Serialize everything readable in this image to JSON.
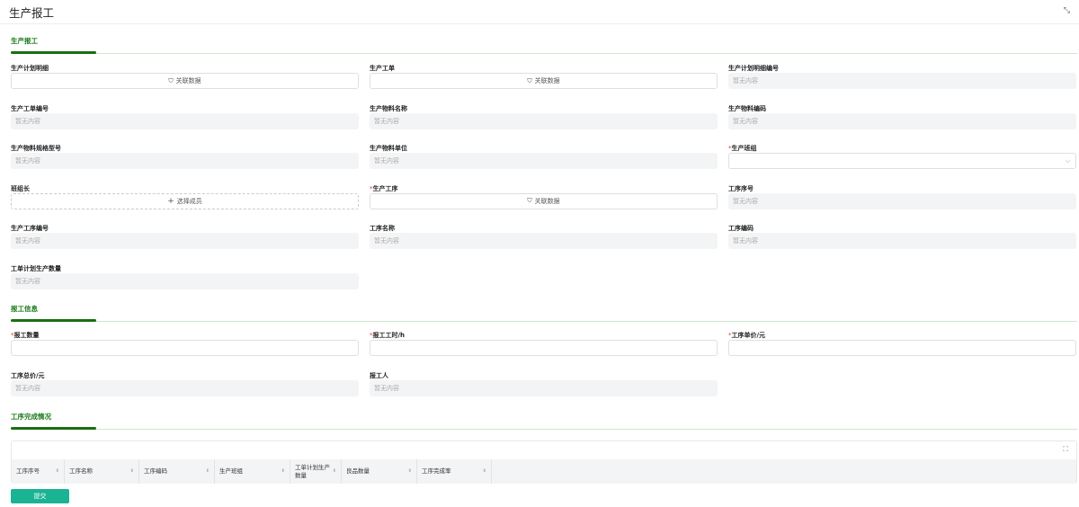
{
  "title": "生产报工",
  "sections": [
    {
      "title": "生产报工",
      "fields": [
        {
          "label": "生产计划明细",
          "required": false,
          "type": "link",
          "value": "关联数据"
        },
        {
          "label": "生产工单",
          "required": false,
          "type": "link",
          "value": "关联数据"
        },
        {
          "label": "生产计划明细编号",
          "required": false,
          "type": "ro",
          "value": "暂无内容"
        },
        {
          "label": "生产工单编号",
          "required": false,
          "type": "ro",
          "value": "暂无内容"
        },
        {
          "label": "生产物料名称",
          "required": false,
          "type": "ro",
          "value": "暂无内容"
        },
        {
          "label": "生产物料编码",
          "required": false,
          "type": "ro",
          "value": "暂无内容"
        },
        {
          "label": "生产物料规格型号",
          "required": false,
          "type": "ro",
          "value": "暂无内容"
        },
        {
          "label": "生产物料单位",
          "required": false,
          "type": "ro",
          "value": "暂无内容"
        },
        {
          "label": "生产班组",
          "required": true,
          "type": "sel",
          "value": ""
        },
        {
          "label": "班组长",
          "required": false,
          "type": "member",
          "value": "选择成员"
        },
        {
          "label": "生产工序",
          "required": true,
          "type": "link",
          "value": "关联数据"
        },
        {
          "label": "工序序号",
          "required": false,
          "type": "ro",
          "value": "暂无内容"
        },
        {
          "label": "生产工序编号",
          "required": false,
          "type": "ro",
          "value": "暂无内容"
        },
        {
          "label": "工序名称",
          "required": false,
          "type": "ro",
          "value": "暂无内容"
        },
        {
          "label": "工序编码",
          "required": false,
          "type": "ro",
          "value": "暂无内容"
        },
        {
          "label": "工单计划生产数量",
          "required": false,
          "type": "ro",
          "value": "暂无内容"
        }
      ]
    },
    {
      "title": "报工信息",
      "fields": [
        {
          "label": "报工数量",
          "required": true,
          "type": "inp",
          "value": ""
        },
        {
          "label": "报工工时/h",
          "required": true,
          "type": "inp",
          "value": ""
        },
        {
          "label": "工序单价/元",
          "required": true,
          "type": "inp",
          "value": ""
        },
        {
          "label": "工序总价/元",
          "required": false,
          "type": "ro",
          "value": "暂无内容"
        },
        {
          "label": "报工人",
          "required": false,
          "type": "ro",
          "value": "暂无内容"
        }
      ]
    },
    {
      "title": "工序完成情况"
    }
  ],
  "table": {
    "columns": [
      {
        "label": "工序序号",
        "w": 57
      },
      {
        "label": "工序名称",
        "w": 81
      },
      {
        "label": "工序编码",
        "w": 82
      },
      {
        "label": "生产班组",
        "w": 82
      },
      {
        "label": "工单计划生产数量",
        "w": 55
      },
      {
        "label": "良品数量",
        "w": 82
      },
      {
        "label": "工序完成率",
        "w": 81
      }
    ]
  },
  "submit": "提交"
}
